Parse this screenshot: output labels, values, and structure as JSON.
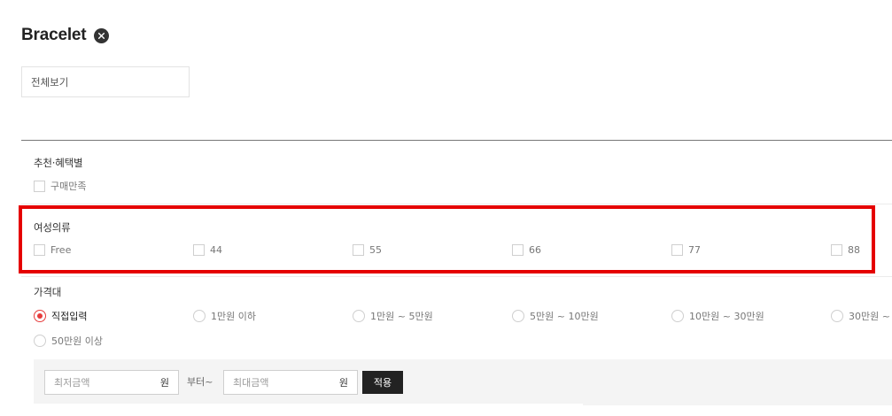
{
  "header": {
    "title": "Bracelet"
  },
  "view_all": {
    "label": "전체보기"
  },
  "sections": {
    "recommend": {
      "label": "추천·혜택별",
      "options": [
        "구매만족"
      ]
    },
    "size": {
      "label": "여성의류",
      "options": [
        "Free",
        "44",
        "55",
        "66",
        "77",
        "88"
      ]
    },
    "price": {
      "label": "가격대",
      "selected_index": 0,
      "options": [
        "직접입력",
        "1만원 이하",
        "1만원 ~ 5만원",
        "5만원 ~ 10만원",
        "10만원 ~ 30만원",
        "30만원 ~",
        "50만원 이상"
      ],
      "min_placeholder": "최저금액",
      "max_placeholder": "최대금액",
      "unit": "원",
      "range_separator": "부터~",
      "apply_label": "적용"
    }
  },
  "colors": {
    "highlight": "#e50000",
    "radio_selected": "#e63c3c",
    "apply_button": "#222222"
  }
}
